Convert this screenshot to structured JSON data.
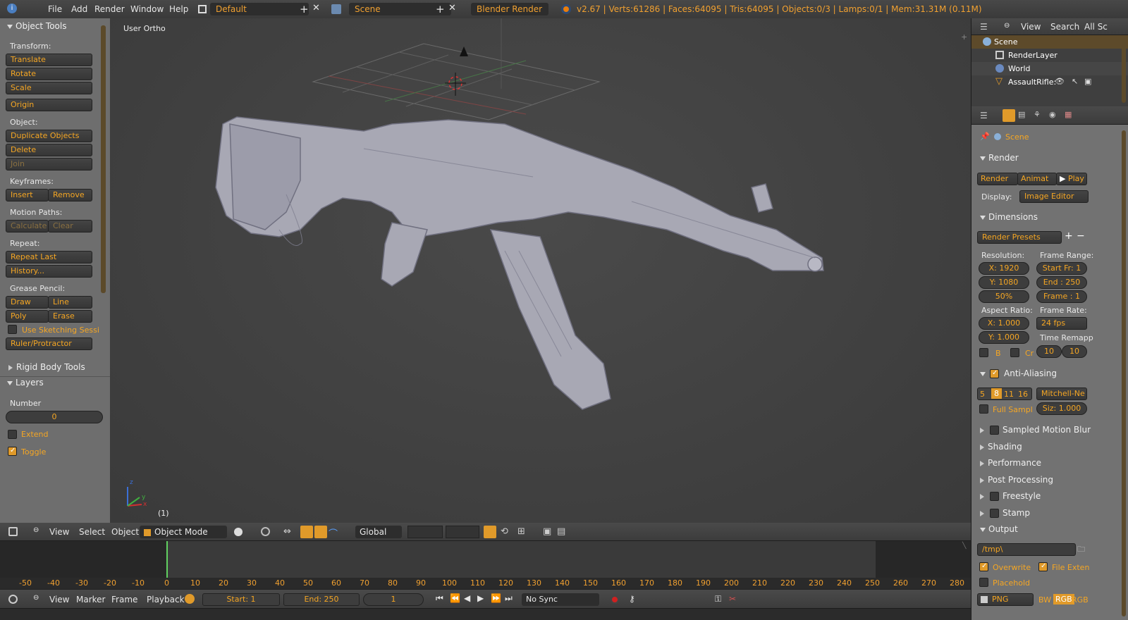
{
  "topbar": {
    "menus": [
      "File",
      "Add",
      "Render",
      "Window",
      "Help"
    ],
    "layout": "Default",
    "scene": "Scene",
    "engine": "Blender Render",
    "stats": "v2.67 | Verts:61286 | Faces:64095 | Tris:64095 | Objects:0/3 | Lamps:0/1 | Mem:31.31M (0.11M)"
  },
  "toolshelf": {
    "title": "Object Tools",
    "transform_label": "Transform:",
    "translate": "Translate",
    "rotate": "Rotate",
    "scale": "Scale",
    "origin": "Origin",
    "object_label": "Object:",
    "duplicate": "Duplicate Objects",
    "delete": "Delete",
    "join": "Join",
    "keyframes_label": "Keyframes:",
    "insert": "Insert",
    "remove": "Remove",
    "motion_paths_label": "Motion Paths:",
    "calculate": "Calculate",
    "clear": "Clear",
    "repeat_label": "Repeat:",
    "repeat_last": "Repeat Last",
    "history": "History...",
    "grease_label": "Grease Pencil:",
    "draw": "Draw",
    "line": "Line",
    "poly": "Poly",
    "erase": "Erase",
    "sketching": "Use Sketching Sessi",
    "ruler": "Ruler/Protractor",
    "rigid_body": "Rigid Body Tools"
  },
  "layers": {
    "title": "Layers",
    "number_label": "Number",
    "number_value": "0",
    "extend": "Extend",
    "toggle": "Toggle"
  },
  "viewport": {
    "view_name": "User Ortho",
    "frame_indicator": "(1)",
    "axis_x": "x",
    "axis_y": "y",
    "axis_z": "z"
  },
  "view_header": {
    "view": "View",
    "select": "Select",
    "object": "Object",
    "mode": "Object Mode",
    "orientation": "Global"
  },
  "outliner": {
    "view": "View",
    "search": "Search",
    "all_scenes": "All Sc",
    "items": [
      "Scene",
      "RenderLayer",
      "World",
      "AssaultRifle:"
    ]
  },
  "properties": {
    "scene": "Scene",
    "render_section": "Render",
    "render_btn": "Render",
    "animation_btn": "Animat",
    "play_btn": "Play",
    "display_label": "Display:",
    "display_value": "Image Editor",
    "dimensions": "Dimensions",
    "render_presets": "Render Presets",
    "resolution_label": "Resolution:",
    "res_x": "X: 1920",
    "res_y": "Y: 1080",
    "res_pct": "50%",
    "frame_range_label": "Frame Range:",
    "start_fr": "Start Fr: 1",
    "end_fr": "End : 250",
    "frame_step": "Frame : 1",
    "aspect_label": "Aspect Ratio:",
    "aspect_x": "X: 1.000",
    "aspect_y": "Y: 1.000",
    "frame_rate_label": "Frame Rate:",
    "fps": "24 fps",
    "time_remap": "Time Remapp",
    "border": "B",
    "crop": "Cr",
    "remap_old": "10",
    "remap_new": "10",
    "anti_aliasing": "Anti-Aliasing",
    "aa_samples": [
      "5",
      "8",
      "11",
      "16"
    ],
    "aa_filter": "Mitchell-Ne",
    "full_sample": "Full Sampl",
    "filter_size": "Siz: 1.000",
    "sampled_motion_blur": "Sampled Motion Blur",
    "shading": "Shading",
    "performance": "Performance",
    "post_processing": "Post Processing",
    "freestyle": "Freestyle",
    "stamp": "Stamp",
    "output": "Output",
    "output_path": "/tmp\\",
    "overwrite": "Overwrite",
    "file_extensions": "File Exten",
    "placeholders": "Placehold",
    "format": "PNG",
    "color_modes": [
      "BW",
      "RGB",
      "RGB"
    ]
  },
  "timeline": {
    "ticks": [
      "-50",
      "-40",
      "-30",
      "-20",
      "-10",
      "0",
      "10",
      "20",
      "30",
      "40",
      "50",
      "60",
      "70",
      "80",
      "90",
      "100",
      "110",
      "120",
      "130",
      "140",
      "150",
      "160",
      "170",
      "180",
      "190",
      "200",
      "210",
      "220",
      "230",
      "240",
      "250",
      "260",
      "270",
      "280"
    ],
    "current_frame_marker": 0
  },
  "timeline_header": {
    "view": "View",
    "marker": "Marker",
    "frame": "Frame",
    "playback": "Playback",
    "start": "Start: 1",
    "end": "End: 250",
    "current": "1",
    "sync": "No Sync"
  },
  "colors": {
    "accent": "#f0a030",
    "panel_bg": "#727272",
    "viewport_bg": "#393939"
  }
}
